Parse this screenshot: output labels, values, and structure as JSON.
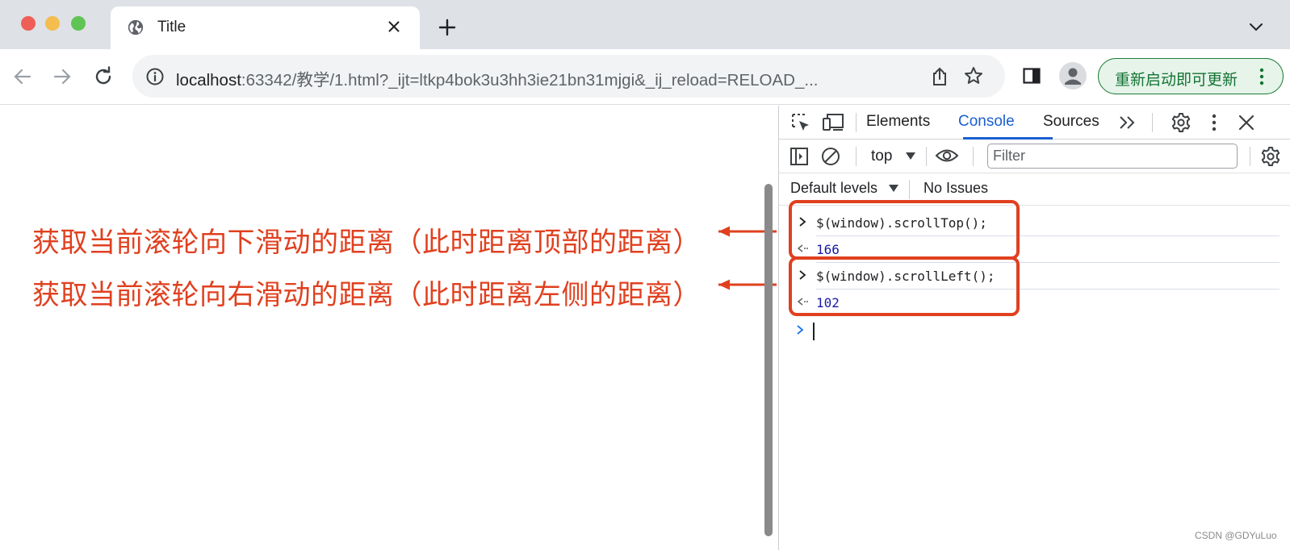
{
  "browser": {
    "tab": {
      "title": "Title"
    },
    "address": {
      "host": "localhost",
      "rest": ":63342/教学/1.html?_ijt=ltkp4bok3u3hh3ie21bn31mjgi&_ij_reload=RELOAD_..."
    },
    "update_button_label": "重新启动即可更新"
  },
  "annotations": [
    "获取当前滚轮向下滑动的距离（此时距离顶部的距离）",
    "获取当前滚轮向右滑动的距离（此时距离左侧的距离）"
  ],
  "devtools": {
    "tabs": [
      {
        "label": "Elements"
      },
      {
        "label": "Console",
        "active": true
      },
      {
        "label": "Sources"
      }
    ],
    "context": "top",
    "filter_placeholder": "Filter",
    "levels": "Default levels",
    "issues": "No Issues",
    "console": [
      {
        "input": "$(window).scrollTop();",
        "result": "166"
      },
      {
        "input": "$(window).scrollLeft();",
        "result": "102"
      }
    ]
  },
  "watermark": "CSDN @GDYuLuo",
  "colors": {
    "annotation": "#e0401f",
    "active_tab": "#1a5fd1",
    "update_border": "#1e7e34"
  }
}
